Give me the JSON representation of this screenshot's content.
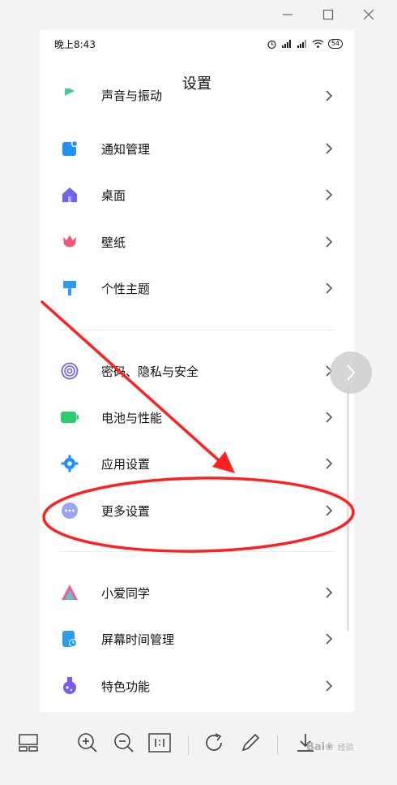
{
  "status_bar": {
    "time": "晚上8:43",
    "battery": "54"
  },
  "page": {
    "title": "设置"
  },
  "settings": {
    "items": [
      {
        "label": "声音与振动",
        "icon": "sound-icon",
        "color": "#3ccf8e"
      },
      {
        "label": "通知管理",
        "icon": "notification-icon",
        "color": "#1e90ff"
      },
      {
        "label": "桌面",
        "icon": "home-icon",
        "color": "#6f63f0"
      },
      {
        "label": "壁纸",
        "icon": "tulip-icon",
        "color": "#f0577a"
      },
      {
        "label": "个性主题",
        "icon": "brush-icon",
        "color": "#2c9cf0"
      },
      {
        "label": "密码、隐私与安全",
        "icon": "fingerprint-icon",
        "color": "#6f63f0"
      },
      {
        "label": "电池与性能",
        "icon": "battery-icon",
        "color": "#2ecc71"
      },
      {
        "label": "应用设置",
        "icon": "gear-icon",
        "color": "#1e90ff"
      },
      {
        "label": "更多设置",
        "icon": "more-icon",
        "color": "#9aa7ef"
      },
      {
        "label": "小爱同学",
        "icon": "xiaoai-icon",
        "color": "#f06292"
      },
      {
        "label": "屏幕时间管理",
        "icon": "screen-time-icon",
        "color": "#2c9cf0"
      },
      {
        "label": "特色功能",
        "icon": "flask-icon",
        "color": "#7a5cf0"
      }
    ]
  },
  "watermark": {
    "text": "Bai",
    "sub": "经验"
  },
  "colors": {
    "annotation": "#ff2020",
    "accent": "#1e90ff"
  }
}
